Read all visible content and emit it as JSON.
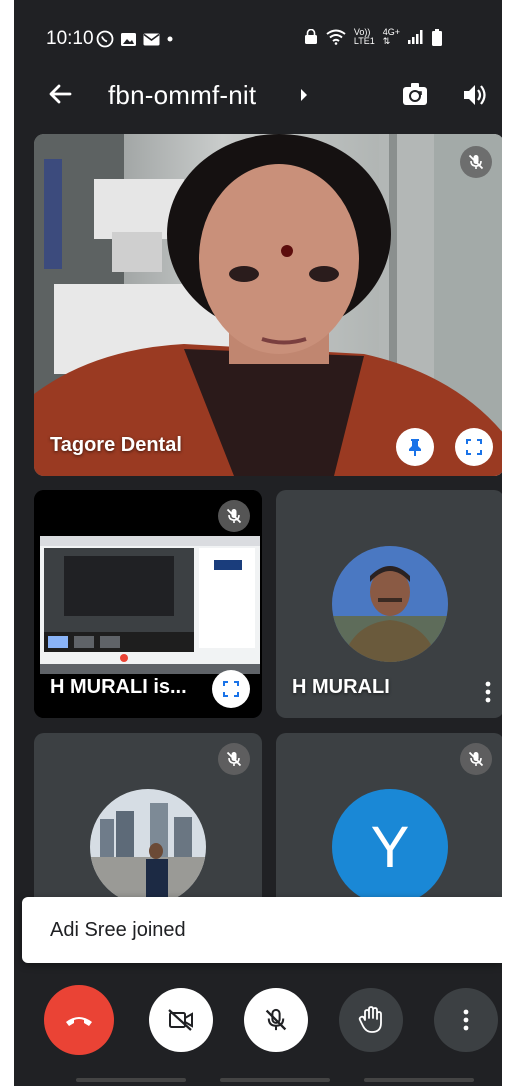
{
  "status_bar": {
    "time": "10:10",
    "left_icons": [
      "whatsapp-icon",
      "gallery-icon",
      "mail-icon",
      "dot-icon"
    ],
    "right_icons": [
      "lock-icon",
      "wifi-icon",
      "volte-icon",
      "signal-icon",
      "battery-icon"
    ],
    "volte_top": "Vo))",
    "volte_bottom": "LTE1",
    "net_top": "4G+"
  },
  "header": {
    "meeting_code": "fbn-ommf-nit"
  },
  "participants": {
    "main": {
      "name": "Tagore Dental"
    },
    "screen_share": {
      "name": "H MURALI is..."
    },
    "hmurali": {
      "name": "H MURALI"
    },
    "y_user": {
      "initial": "Y",
      "avatar_color": "#1a88d6"
    }
  },
  "toast": {
    "text": "Adi Sree joined"
  },
  "colors": {
    "background": "#202124",
    "tile": "#3c4043",
    "end_call": "#ea4335"
  }
}
